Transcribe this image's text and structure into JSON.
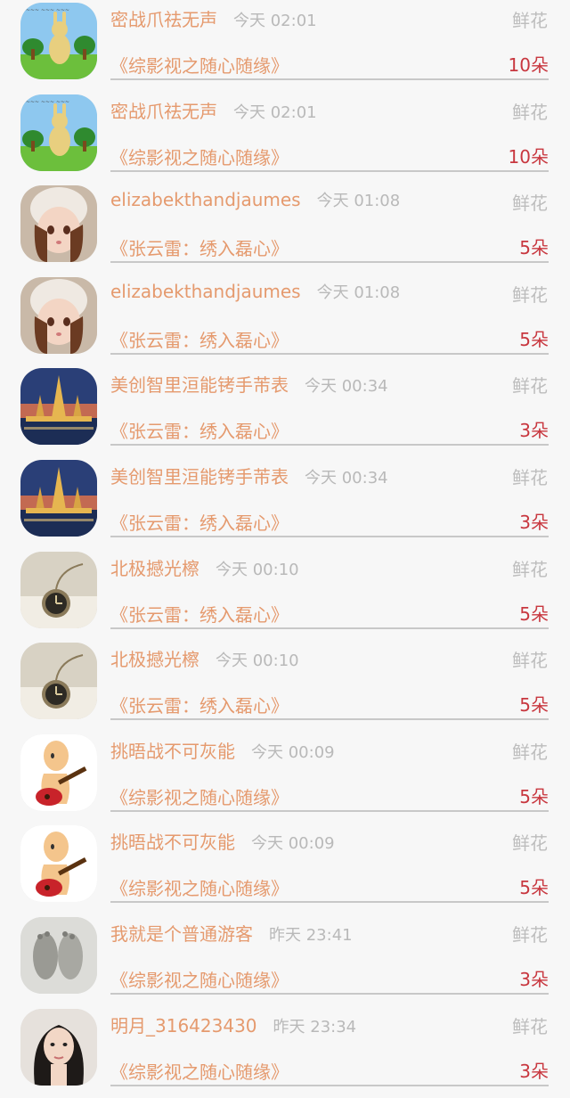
{
  "gift_list": [
    {
      "user": "密战爪祛无声",
      "time": "今天 02:01",
      "gift_type": "鲜花",
      "book": "《综影视之随心随缘》",
      "count": "10朵",
      "avatar_icon": "rabbit-cartoon-avatar"
    },
    {
      "user": "密战爪祛无声",
      "time": "今天 02:01",
      "gift_type": "鲜花",
      "book": "《综影视之随心随缘》",
      "count": "10朵",
      "avatar_icon": "rabbit-cartoon-avatar"
    },
    {
      "user": "elizabekthandjaumes",
      "time": "今天 01:08",
      "gift_type": "鲜花",
      "book": "《张云雷：绣入磊心》",
      "count": "5朵",
      "avatar_icon": "doll-avatar"
    },
    {
      "user": "elizabekthandjaumes",
      "time": "今天 01:08",
      "gift_type": "鲜花",
      "book": "《张云雷：绣入磊心》",
      "count": "5朵",
      "avatar_icon": "doll-avatar"
    },
    {
      "user": "美创智里洹能铐手芾表",
      "time": "今天 00:34",
      "gift_type": "鲜花",
      "book": "《张云雷：绣入磊心》",
      "count": "3朵",
      "avatar_icon": "temple-avatar"
    },
    {
      "user": "美创智里洹能铐手芾表",
      "time": "今天 00:34",
      "gift_type": "鲜花",
      "book": "《张云雷：绣入磊心》",
      "count": "3朵",
      "avatar_icon": "temple-avatar"
    },
    {
      "user": "北极撼光檫",
      "time": "今天 00:10",
      "gift_type": "鲜花",
      "book": "《张云雷：绣入磊心》",
      "count": "5朵",
      "avatar_icon": "pocket-watch-avatar"
    },
    {
      "user": "北极撼光檫",
      "time": "今天 00:10",
      "gift_type": "鲜花",
      "book": "《张云雷：绣入磊心》",
      "count": "5朵",
      "avatar_icon": "pocket-watch-avatar"
    },
    {
      "user": "挑晤战不可灰能",
      "time": "今天 00:09",
      "gift_type": "鲜花",
      "book": "《综影视之随心随缘》",
      "count": "5朵",
      "avatar_icon": "guitar-cartoon-avatar"
    },
    {
      "user": "挑晤战不可灰能",
      "time": "今天 00:09",
      "gift_type": "鲜花",
      "book": "《综影视之随心随缘》",
      "count": "5朵",
      "avatar_icon": "guitar-cartoon-avatar"
    },
    {
      "user": "我就是个普通游客",
      "time": "昨天 23:41",
      "gift_type": "鲜花",
      "book": "《综影视之随心随缘》",
      "count": "3朵",
      "avatar_icon": "baby-feet-avatar"
    },
    {
      "user": "明月_316423430",
      "time": "昨天 23:34",
      "gift_type": "鲜花",
      "book": "《综影视之随心随缘》",
      "count": "3朵",
      "avatar_icon": "girl-portrait-avatar"
    }
  ],
  "colors": {
    "accent_orange": "#e59a6e",
    "count_red": "#c8373f",
    "muted_gray": "#bdbdbd",
    "background": "#f7f7f7"
  }
}
